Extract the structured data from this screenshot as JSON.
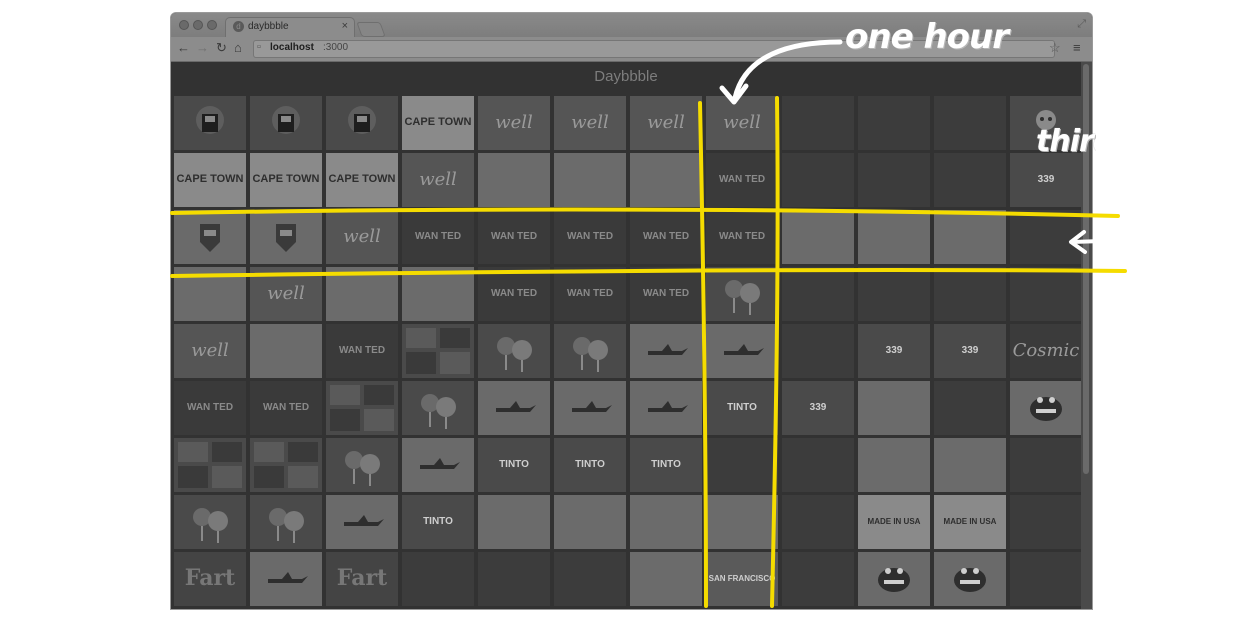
{
  "browser": {
    "tab_title": "daybbble",
    "tab_favicon": "d",
    "tab_close": "×",
    "url_host": "localhost",
    "url_port": ":3000",
    "back_icon": "←",
    "forward_icon": "→",
    "reload_icon": "↻",
    "home_icon": "⌂",
    "page_icon": "▫",
    "star_icon": "☆",
    "menu_icon": "≡",
    "fullscreen_icon": "⤢"
  },
  "page": {
    "title": "Daybbble"
  },
  "grid": {
    "rows": 9,
    "cols": 12,
    "labels": {
      "well": "well",
      "cape": "CAPE TOWN",
      "wanted": "WAN TED",
      "tinto": "TINTO",
      "made": "MADE IN USA",
      "cosmic": "Cosmic",
      "fart": "Fart",
      "n339": "339",
      "san": "SAN FRANCISCO"
    },
    "cells": [
      [
        "robot",
        "robot",
        "robot",
        "cape",
        "well",
        "well",
        "well",
        "well",
        "dark",
        "dark",
        "dark",
        "skull"
      ],
      [
        "cape",
        "cape",
        "cape",
        "well",
        "light",
        "light",
        "light",
        "wanted",
        "dark",
        "dark",
        "dark",
        "n339"
      ],
      [
        "badge",
        "badge",
        "well",
        "wanted",
        "wanted",
        "wanted",
        "wanted",
        "wanted",
        "light",
        "light",
        "light",
        "dark"
      ],
      [
        "light",
        "well",
        "light",
        "light",
        "wanted",
        "wanted",
        "wanted",
        "lollipop",
        "dark",
        "dark",
        "dark",
        "dark"
      ],
      [
        "well",
        "light",
        "wanted",
        "pattern",
        "lollipop",
        "lollipop",
        "plane",
        "plane",
        "dark",
        "n339",
        "n339",
        "cosmic"
      ],
      [
        "wanted",
        "wanted",
        "pattern",
        "lollipop",
        "plane",
        "plane",
        "plane",
        "tinto",
        "n339",
        "light",
        "dark",
        "frog"
      ],
      [
        "pattern",
        "pattern",
        "lollipop",
        "plane",
        "tinto",
        "tinto",
        "tinto",
        "dark",
        "dark",
        "light",
        "light",
        "dark"
      ],
      [
        "lollipop",
        "lollipop",
        "plane",
        "tinto",
        "light",
        "light",
        "light",
        "light",
        "dark",
        "made",
        "made",
        "dark"
      ],
      [
        "fart",
        "plane",
        "fart",
        "dark",
        "dark",
        "dark",
        "light",
        "san",
        "dark",
        "frog",
        "frog",
        "dark"
      ]
    ]
  },
  "annotations": {
    "one_hour": "one hour",
    "third": "third"
  },
  "colors": {
    "highlight": "#f5dc00",
    "annotation_text": "#ffffff",
    "tile_dark": "#3c3c3c",
    "tile_mid": "#4f4f4f",
    "tile_light": "#6b6b6b"
  }
}
